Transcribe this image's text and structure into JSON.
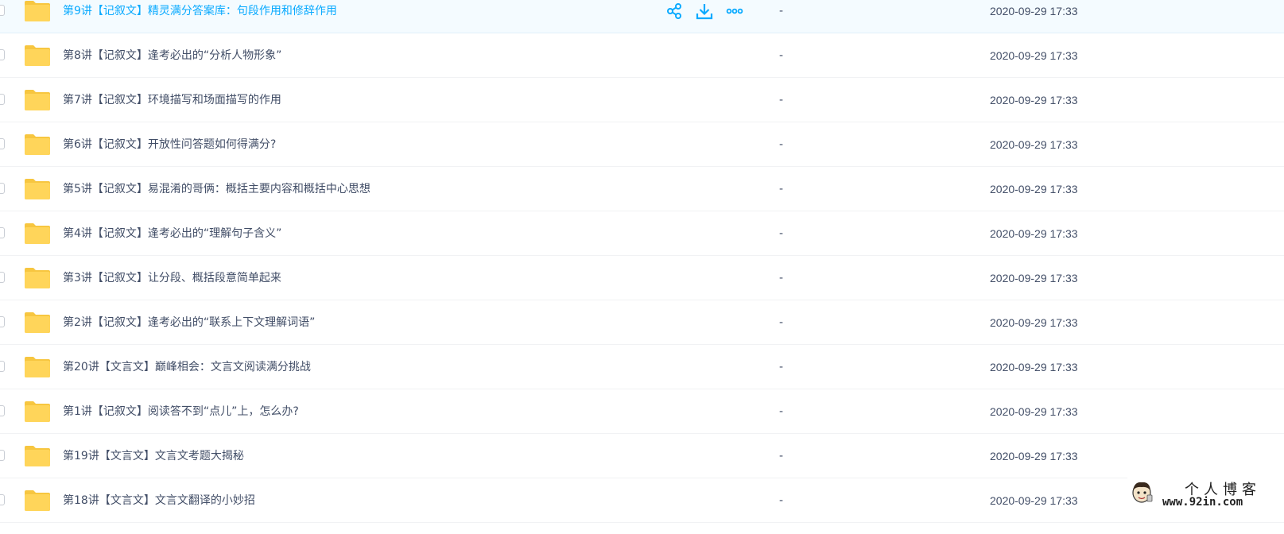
{
  "colors": {
    "folder": "#ffd55a",
    "folder_tab": "#f7c640",
    "accent": "#09aaff",
    "text": "#424e67"
  },
  "actions": {
    "share_icon": "share-icon",
    "download_icon": "download-icon",
    "more_icon": "more-icon"
  },
  "files": [
    {
      "name": "第9讲【记叙文】精灵满分答案库：句段作用和修辞作用",
      "size": "-",
      "date": "2020-09-29 17:33",
      "hover": true
    },
    {
      "name": "第8讲【记叙文】逢考必出的“分析人物形象”",
      "size": "-",
      "date": "2020-09-29 17:33"
    },
    {
      "name": "第7讲【记叙文】环境描写和场面描写的作用",
      "size": "-",
      "date": "2020-09-29 17:33"
    },
    {
      "name": "第6讲【记叙文】开放性问答题如何得满分?",
      "size": "-",
      "date": "2020-09-29 17:33"
    },
    {
      "name": "第5讲【记叙文】易混淆的哥俩：概括主要内容和概括中心思想",
      "size": "-",
      "date": "2020-09-29 17:33"
    },
    {
      "name": "第4讲【记叙文】逢考必出的“理解句子含义”",
      "size": "-",
      "date": "2020-09-29 17:33"
    },
    {
      "name": "第3讲【记叙文】让分段、概括段意简单起来",
      "size": "-",
      "date": "2020-09-29 17:33"
    },
    {
      "name": "第2讲【记叙文】逢考必出的“联系上下文理解词语”",
      "size": "-",
      "date": "2020-09-29 17:33"
    },
    {
      "name": "第20讲【文言文】巅峰相会：文言文阅读满分挑战",
      "size": "-",
      "date": "2020-09-29 17:33"
    },
    {
      "name": "第1讲【记叙文】阅读答不到“点儿”上，怎么办?",
      "size": "-",
      "date": "2020-09-29 17:33"
    },
    {
      "name": "第19讲【文言文】文言文考题大揭秘",
      "size": "-",
      "date": "2020-09-29 17:33"
    },
    {
      "name": "第18讲【文言文】文言文翻译的小妙招",
      "size": "-",
      "date": "2020-09-29 17:33"
    }
  ],
  "watermark": {
    "title": "个人博客",
    "url": "www.92in.com"
  }
}
